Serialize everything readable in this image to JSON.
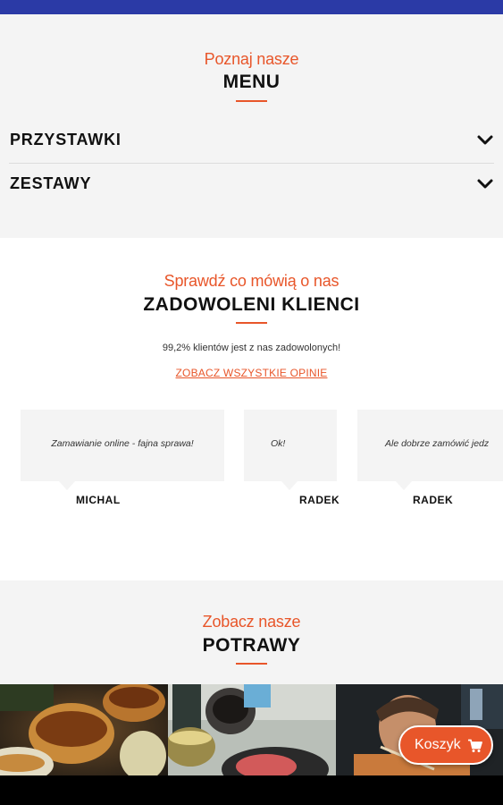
{
  "menu": {
    "subtitle": "Poznaj nasze",
    "title": "MENU",
    "categories": [
      {
        "label": "PRZYSTAWKI",
        "icon": "chevron-down-icon"
      },
      {
        "label": "ZESTAWY",
        "icon": "chevron-down-icon"
      }
    ]
  },
  "reviews": {
    "subtitle": "Sprawdź co mówią o nas",
    "title": "ZADOWOLENI KLIENCI",
    "stat": "99,2% klientów jest z nas zadowolonych!",
    "all_link": "ZOBACZ WSZYSTKIE OPINIE",
    "items": [
      {
        "text": "Zamawianie online - fajna sprawa!",
        "author": "MICHAL"
      },
      {
        "text": "Ok!",
        "author": "RADEK"
      },
      {
        "text": "Ale dobrze zamówić jedz",
        "author": "RADEK"
      }
    ]
  },
  "dishes": {
    "subtitle": "Zobacz nasze",
    "title": "POTRAWY"
  },
  "cart": {
    "label": "Koszyk",
    "icon": "cart-icon"
  },
  "colors": {
    "accent": "#e8562a",
    "topbar": "#2b3aa6",
    "section_bg": "#f4f4f4"
  }
}
